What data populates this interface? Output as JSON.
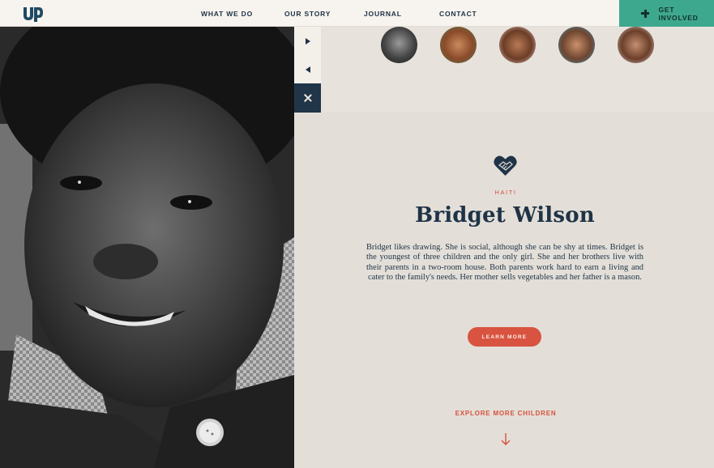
{
  "header": {
    "logo_text": "UP",
    "nav": [
      "WHAT WE DO",
      "OUR STORY",
      "JOURNAL",
      "CONTACT"
    ],
    "cta_label": "GET INVOLVED",
    "cta_icon": "plus-icon"
  },
  "gallery": {
    "next_icon": "chevron-right-icon",
    "prev_icon": "chevron-left-icon",
    "close_icon": "close-icon",
    "thumbnail_count": 5
  },
  "profile": {
    "icon": "heart-handshake-icon",
    "country": "HAITI",
    "name": "Bridget Wilson",
    "bio": "Bridget likes drawing. She is social, although she can be shy at times. Bridget is the youngest of three children and the only girl. She and her brothers live with their parents in a two-room house. Both parents work hard to earn a living and cater to the family's needs. Her mother sells vegetables and her father is a mason.",
    "button_label": "LEARN MORE"
  },
  "footer": {
    "explore_label": "EXPLORE MORE CHILDREN",
    "arrow_icon": "arrow-down-icon"
  },
  "colors": {
    "navy": "#1f3346",
    "accent_red": "#d85440",
    "cta_green": "#3ea88e",
    "paper": "#e3dfd8"
  }
}
